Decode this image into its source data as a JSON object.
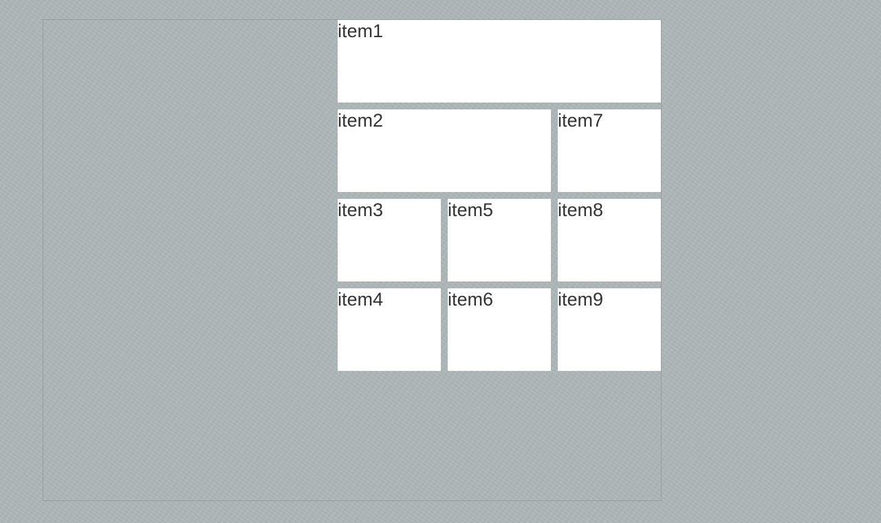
{
  "grid": {
    "items": [
      {
        "label": "item1"
      },
      {
        "label": "item2"
      },
      {
        "label": "item3"
      },
      {
        "label": "item4"
      },
      {
        "label": "item5"
      },
      {
        "label": "item6"
      },
      {
        "label": "item7"
      },
      {
        "label": "item8"
      },
      {
        "label": "item9"
      }
    ]
  },
  "colors": {
    "background": "#aeb7b9",
    "item_background": "#ffffff",
    "text": "#333333",
    "container_border": "#959d9f"
  }
}
